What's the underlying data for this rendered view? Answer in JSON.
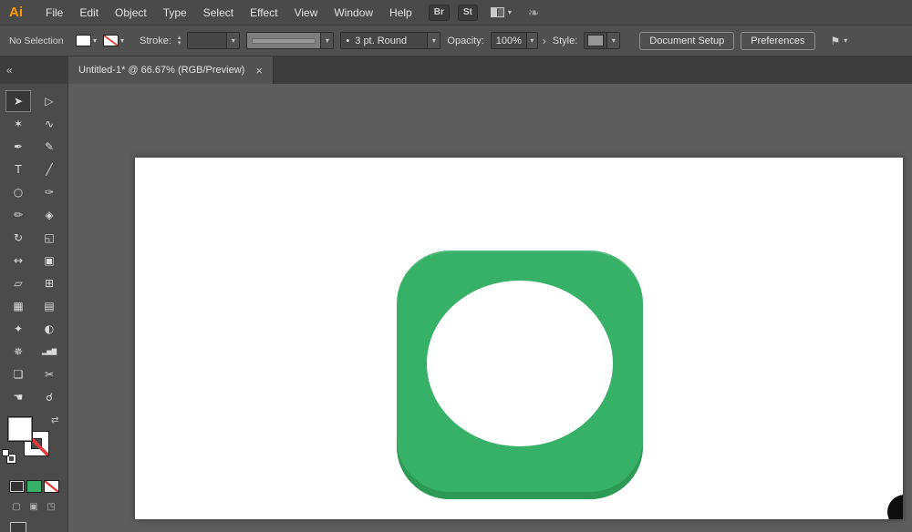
{
  "colors": {
    "accent_orange": "#ff9a00",
    "icon_green": "#36b167",
    "icon_green_edge": "#2c9a55",
    "none_red": "#e03a3a",
    "artboard_white": "#ffffff",
    "offartboard_black": "#0d0d0d"
  },
  "menu": {
    "logo": "Ai",
    "items": [
      "File",
      "Edit",
      "Object",
      "Type",
      "Select",
      "Effect",
      "View",
      "Window",
      "Help"
    ],
    "bridge_button": "Br",
    "stock_button": "St"
  },
  "icons": {
    "dropdown": "▾",
    "stepper_up": "▴",
    "stepper_down": "▾",
    "panel_arrow": "›",
    "swap": "⇄",
    "touch_workspace": "❧",
    "select_similar": "⚑"
  },
  "control": {
    "selection_status": "No Selection",
    "stroke_label": "Stroke:",
    "brush_bullet": "•",
    "brush_definition": "3 pt. Round",
    "opacity_label": "Opacity:",
    "opacity_value": "100%",
    "style_label": "Style:",
    "document_setup_button": "Document Setup",
    "preferences_button": "Preferences"
  },
  "tabbar": {
    "collapse_glyph": "«",
    "tab_title": "Untitled-1* @ 66.67% (RGB/Preview)",
    "close_glyph": "×"
  },
  "tools": [
    {
      "name": "selection-tool",
      "glyph": "➤",
      "active": true
    },
    {
      "name": "direct-selection-tool",
      "glyph": "▷"
    },
    {
      "name": "magic-wand-tool",
      "glyph": "✶"
    },
    {
      "name": "lasso-tool",
      "glyph": "∿"
    },
    {
      "name": "pen-tool",
      "glyph": "✒"
    },
    {
      "name": "curvature-tool",
      "glyph": "✎"
    },
    {
      "name": "type-tool",
      "glyph": "T"
    },
    {
      "name": "line-segment-tool",
      "glyph": "╱"
    },
    {
      "name": "ellipse-tool",
      "glyph": "○"
    },
    {
      "name": "paintbrush-tool",
      "glyph": "✑"
    },
    {
      "name": "pencil-tool",
      "glyph": "✏"
    },
    {
      "name": "eraser-tool",
      "glyph": "◈"
    },
    {
      "name": "rotate-tool",
      "glyph": "↻"
    },
    {
      "name": "scale-tool",
      "glyph": "◱"
    },
    {
      "name": "width-tool",
      "glyph": "↔"
    },
    {
      "name": "free-transform-tool",
      "glyph": "▣"
    },
    {
      "name": "shape-builder-tool",
      "glyph": "▱"
    },
    {
      "name": "perspective-grid-tool",
      "glyph": "⊞"
    },
    {
      "name": "mesh-tool",
      "glyph": "▦"
    },
    {
      "name": "gradient-tool",
      "glyph": "▤"
    },
    {
      "name": "eyedropper-tool",
      "glyph": "✦"
    },
    {
      "name": "blend-tool",
      "glyph": "◐"
    },
    {
      "name": "symbol-sprayer-tool",
      "glyph": "✵"
    },
    {
      "name": "column-graph-tool",
      "glyph": "▂▅▇"
    },
    {
      "name": "artboard-tool",
      "glyph": "❏"
    },
    {
      "name": "slice-tool",
      "glyph": "✂"
    },
    {
      "name": "hand-tool",
      "glyph": "☚"
    },
    {
      "name": "zoom-tool",
      "glyph": "☌"
    }
  ],
  "toolbar_footer": {
    "draw_modes": [
      {
        "name": "draw-normal-mode",
        "glyph": "▢"
      },
      {
        "name": "draw-behind-mode",
        "glyph": "▣"
      },
      {
        "name": "draw-inside-mode",
        "glyph": "◳"
      }
    ]
  }
}
